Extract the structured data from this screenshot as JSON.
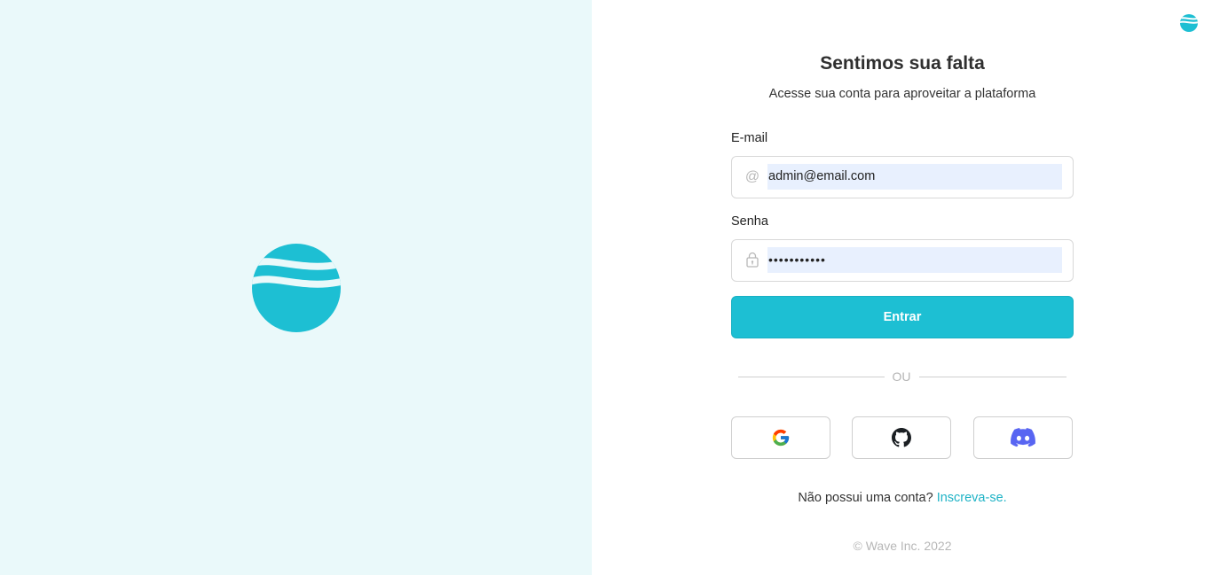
{
  "brand": {
    "logo": "wave-logo",
    "accent_color": "#1dbfd3"
  },
  "login": {
    "title": "Sentimos sua falta",
    "subtitle": "Acesse sua conta para aproveitar a plataforma",
    "email_label": "E-mail",
    "email_value": "admin@email.com",
    "email_icon": "at-icon",
    "password_label": "Senha",
    "password_value": "•••••••••••",
    "password_icon": "lock-icon",
    "submit_label": "Entrar",
    "divider_text": "OU",
    "social": [
      "google-icon",
      "github-icon",
      "discord-icon"
    ]
  },
  "footer": {
    "signup_prompt": "Não possui uma conta?",
    "signup_link": "Inscreva-se.",
    "copyright": "© Wave Inc. 2022"
  }
}
